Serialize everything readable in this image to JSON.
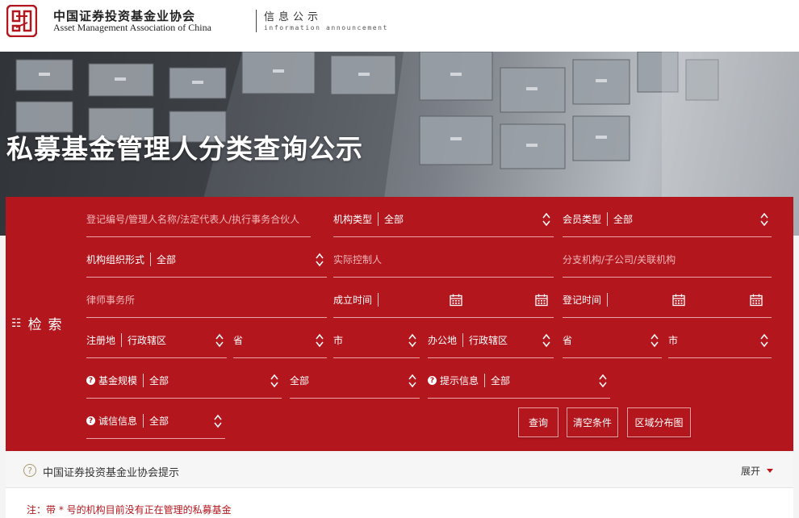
{
  "header": {
    "org_cn": "中国证券投资基金业协会",
    "org_en": "Asset Management Association of China",
    "section_cn": "信息公示",
    "section_en": "information announcement"
  },
  "page_title": "私募基金管理人分类查询公示",
  "search": {
    "side_label": "检索",
    "keyword_placeholder": "登记编号/管理人名称/法定代表人/执行事务合伙人",
    "org_type": {
      "label": "机构类型",
      "value": "全部"
    },
    "member_type": {
      "label": "会员类型",
      "value": "全部"
    },
    "org_form": {
      "label": "机构组织形式",
      "value": "全部"
    },
    "controller_placeholder": "实际控制人",
    "branch_placeholder": "分支机构/子公司/关联机构",
    "law_firm_placeholder": "律师事务所",
    "est_date": {
      "label": "成立时间"
    },
    "reg_date": {
      "label": "登记时间"
    },
    "reg_place": {
      "label": "注册地",
      "value": "行政辖区",
      "province": "省",
      "city": "市"
    },
    "office_place": {
      "label": "办公地",
      "value": "行政辖区",
      "province": "省",
      "city": "市"
    },
    "fund_scale": {
      "label": "基金规模",
      "value": "全部",
      "value2": "全部"
    },
    "hint_info": {
      "label": "提示信息",
      "value": "全部"
    },
    "credit_info": {
      "label": "诚信信息",
      "value": "全部"
    },
    "buttons": {
      "query": "查询",
      "clear": "清空条件",
      "region": "区域分布图"
    }
  },
  "notice": {
    "text": "中国证券投资基金业协会提示",
    "expand": "展开",
    "note": "注：带 * 号的机构目前没有正在管理的私募基金"
  },
  "colors": {
    "panel": "#b4161d",
    "accent": "#c0141c"
  }
}
